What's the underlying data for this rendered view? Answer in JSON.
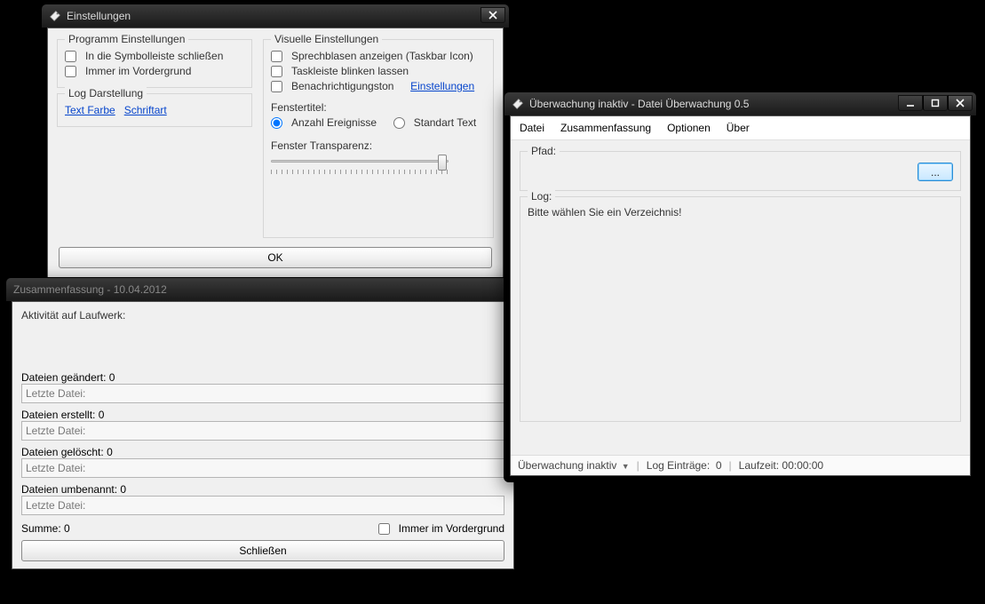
{
  "win1": {
    "title": "Einstellungen",
    "group_program": {
      "legend": "Programm Einstellungen",
      "opt1": "In die Symbolleiste schließen",
      "opt2": "Immer im Vordergrund"
    },
    "group_log": {
      "legend": "Log Darstellung",
      "link1": "Text Farbe",
      "link2": "Schriftart"
    },
    "group_visual": {
      "legend": "Visuelle Einstellungen",
      "opt1": "Sprechblasen anzeigen (Taskbar Icon)",
      "opt2": "Taskleiste blinken lassen",
      "opt3": "Benachrichtigungston",
      "opt3_link": "Einstellungen",
      "fenstertitel_label": "Fenstertitel:",
      "radio1": "Anzahl Ereignisse",
      "radio2": "Standart Text",
      "transparenz_label": "Fenster Transparenz:"
    },
    "ok": "OK"
  },
  "win2": {
    "title": "Zusammenfassung - 10.04.2012",
    "activity_label": "Aktivität auf Laufwerk:",
    "changed_label": "Dateien geändert:",
    "changed_count": "0",
    "created_label": "Dateien erstellt:",
    "created_count": "0",
    "deleted_label": "Dateien gelöscht:",
    "deleted_count": "0",
    "renamed_label": "Dateien umbenannt:",
    "renamed_count": "0",
    "last_file": "Letzte Datei:",
    "sum_label": "Summe:",
    "sum_count": "0",
    "cb_foreground": "Immer im Vordergrund",
    "close": "Schließen"
  },
  "win3": {
    "title": "Überwachung inaktiv - Datei Überwachung 0.5",
    "menu": {
      "m1": "Datei",
      "m2": "Zusammenfassung",
      "m3": "Optionen",
      "m4": "Über"
    },
    "path_label": "Pfad:",
    "browse": "...",
    "log_label": "Log:",
    "log_text": "Bitte wählen Sie ein Verzeichnis!",
    "status": {
      "s1": "Überwachung inaktiv",
      "s2a": "Log Einträge:",
      "s2b": "0",
      "s3a": "Laufzeit:",
      "s3b": "00:00:00"
    }
  }
}
